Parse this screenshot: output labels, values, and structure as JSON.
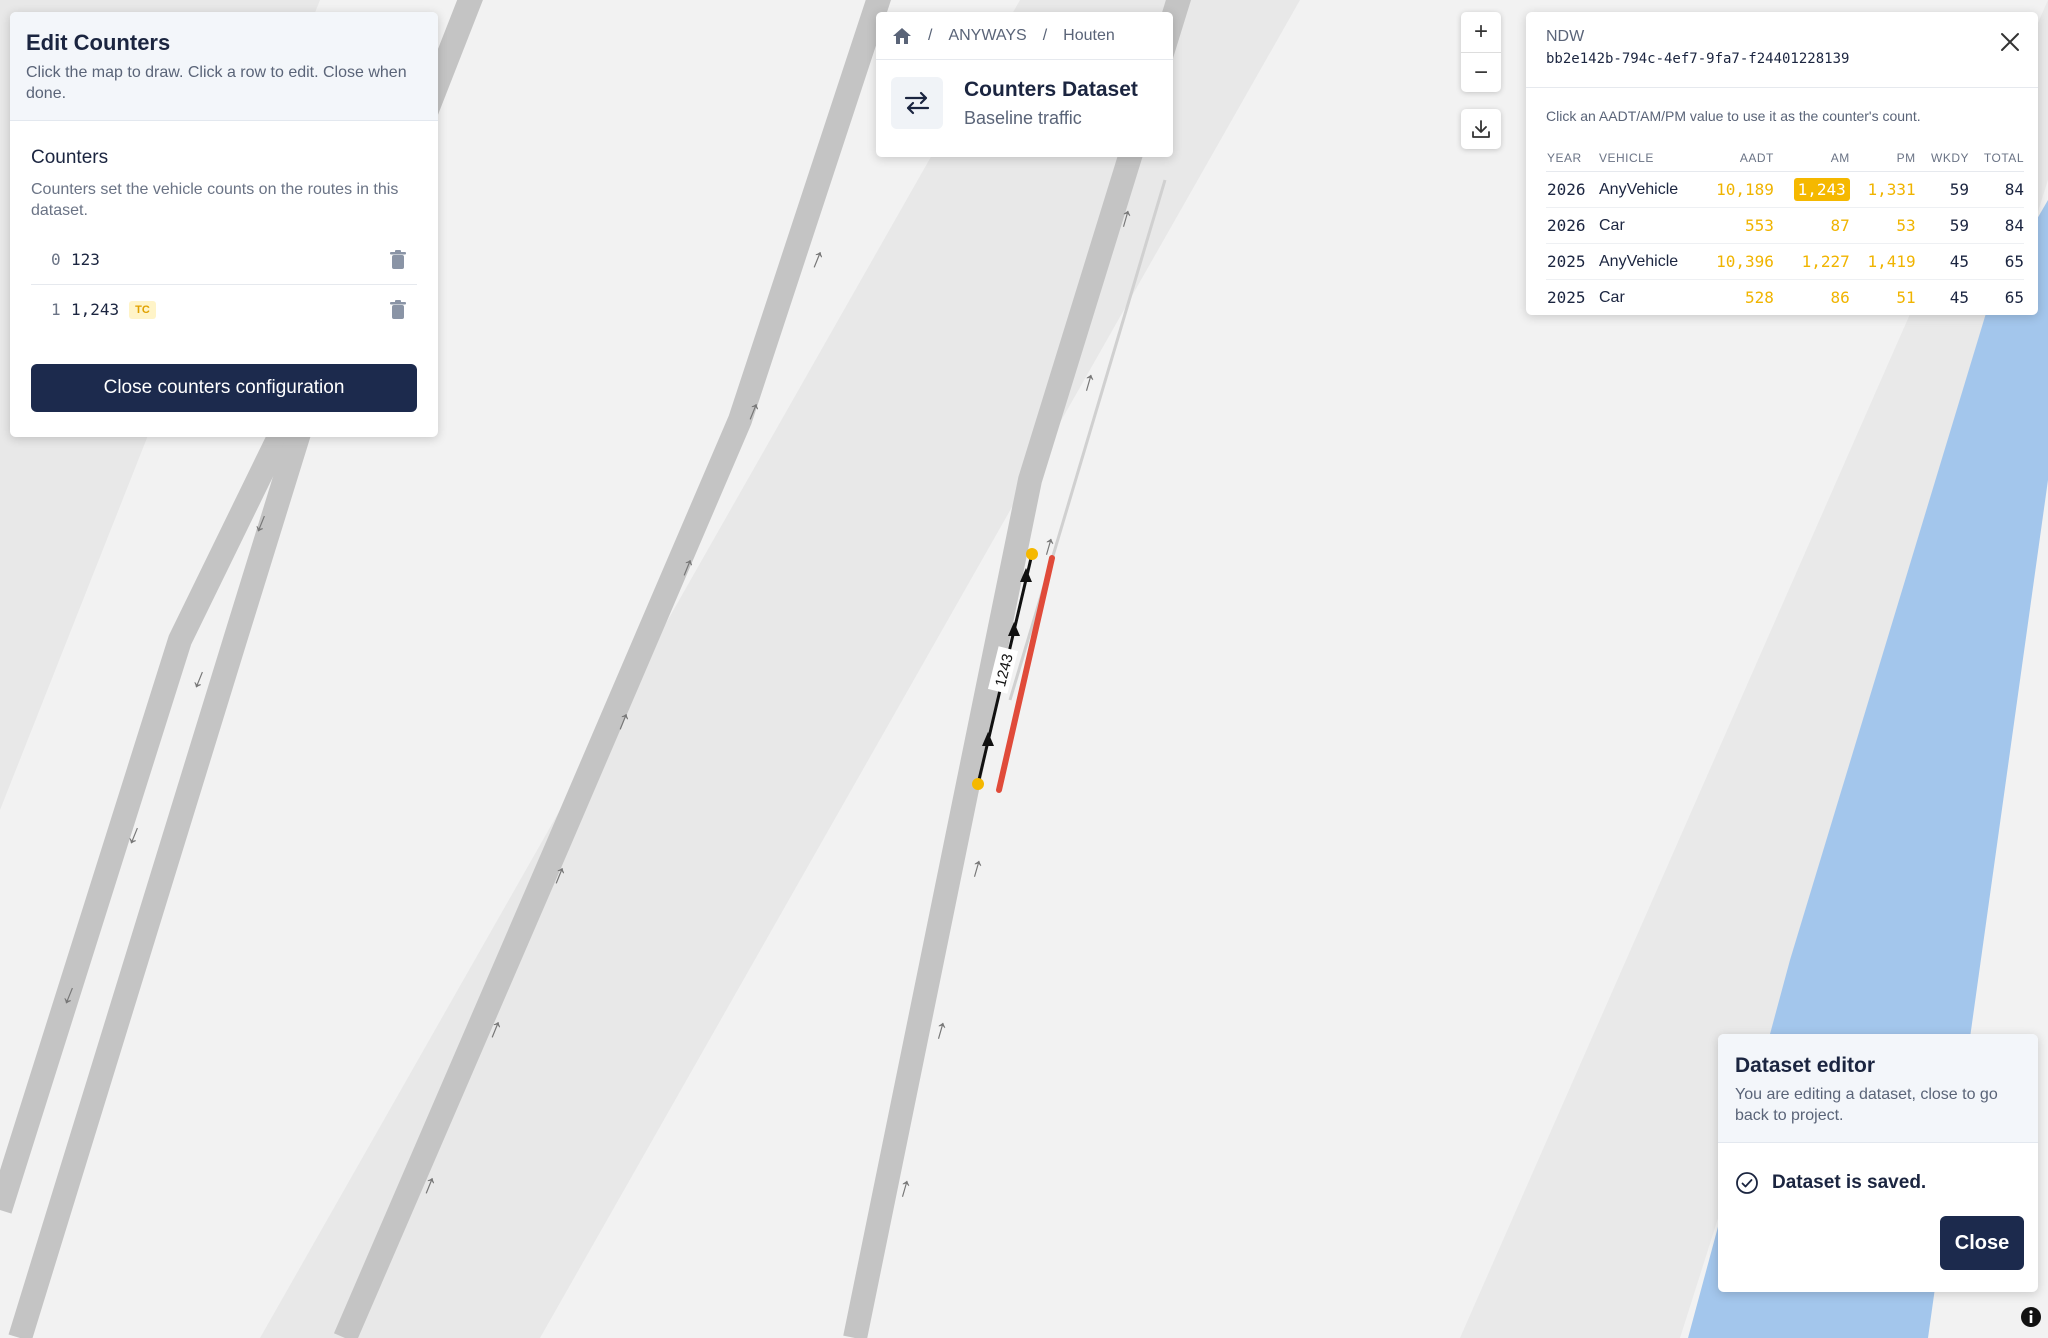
{
  "edit_counters": {
    "title": "Edit Counters",
    "subtitle": "Click the map to draw. Click a row to edit. Close when done.",
    "section_title": "Counters",
    "section_desc": "Counters set the vehicle counts on the routes in this dataset.",
    "counters": [
      {
        "index": "0",
        "value": "123",
        "badge": ""
      },
      {
        "index": "1",
        "value": "1,243",
        "badge": "TC"
      }
    ],
    "close_label": "Close counters configuration"
  },
  "breadcrumb": {
    "items": [
      "ANYWAYS",
      "Houten"
    ],
    "separator": "/",
    "dataset_title": "Counters Dataset",
    "dataset_subtitle": "Baseline traffic"
  },
  "zoom": {
    "in": "+",
    "out": "−"
  },
  "ndw": {
    "source": "NDW",
    "id": "bb2e142b-794c-4ef7-9fa7-f24401228139",
    "hint": "Click an AADT/AM/PM value to use it as the counter's count.",
    "columns": [
      "YEAR",
      "VEHICLE",
      "AADT",
      "AM",
      "PM",
      "WKDY",
      "TOTAL"
    ],
    "rows": [
      {
        "year": "2026",
        "vehicle": "AnyVehicle",
        "aadt": "10,189",
        "am": "1,243",
        "pm": "1,331",
        "wkdy": "59",
        "total": "84"
      },
      {
        "year": "2026",
        "vehicle": "Car",
        "aadt": "553",
        "am": "87",
        "pm": "53",
        "wkdy": "59",
        "total": "84"
      },
      {
        "year": "2025",
        "vehicle": "AnyVehicle",
        "aadt": "10,396",
        "am": "1,227",
        "pm": "1,419",
        "wkdy": "45",
        "total": "65"
      },
      {
        "year": "2025",
        "vehicle": "Car",
        "aadt": "528",
        "am": "86",
        "pm": "51",
        "wkdy": "45",
        "total": "65"
      }
    ],
    "highlighted": {
      "row": 0,
      "column": "AM"
    }
  },
  "dataset_editor": {
    "title": "Dataset editor",
    "subtitle": "You are editing a dataset, close to go back to project.",
    "status": "Dataset is saved.",
    "close_label": "Close"
  },
  "map": {
    "route_label": "1243",
    "colors": {
      "background": "#f2f2f2",
      "road": "#c4c4c4",
      "water": "#a3c6ec",
      "route": "#e04b3a",
      "node": "#f5b800"
    }
  },
  "icons": [
    "home-icon",
    "swap-arrows-icon",
    "download-icon",
    "close-icon",
    "trash-icon",
    "check-circle-icon",
    "info-icon"
  ]
}
